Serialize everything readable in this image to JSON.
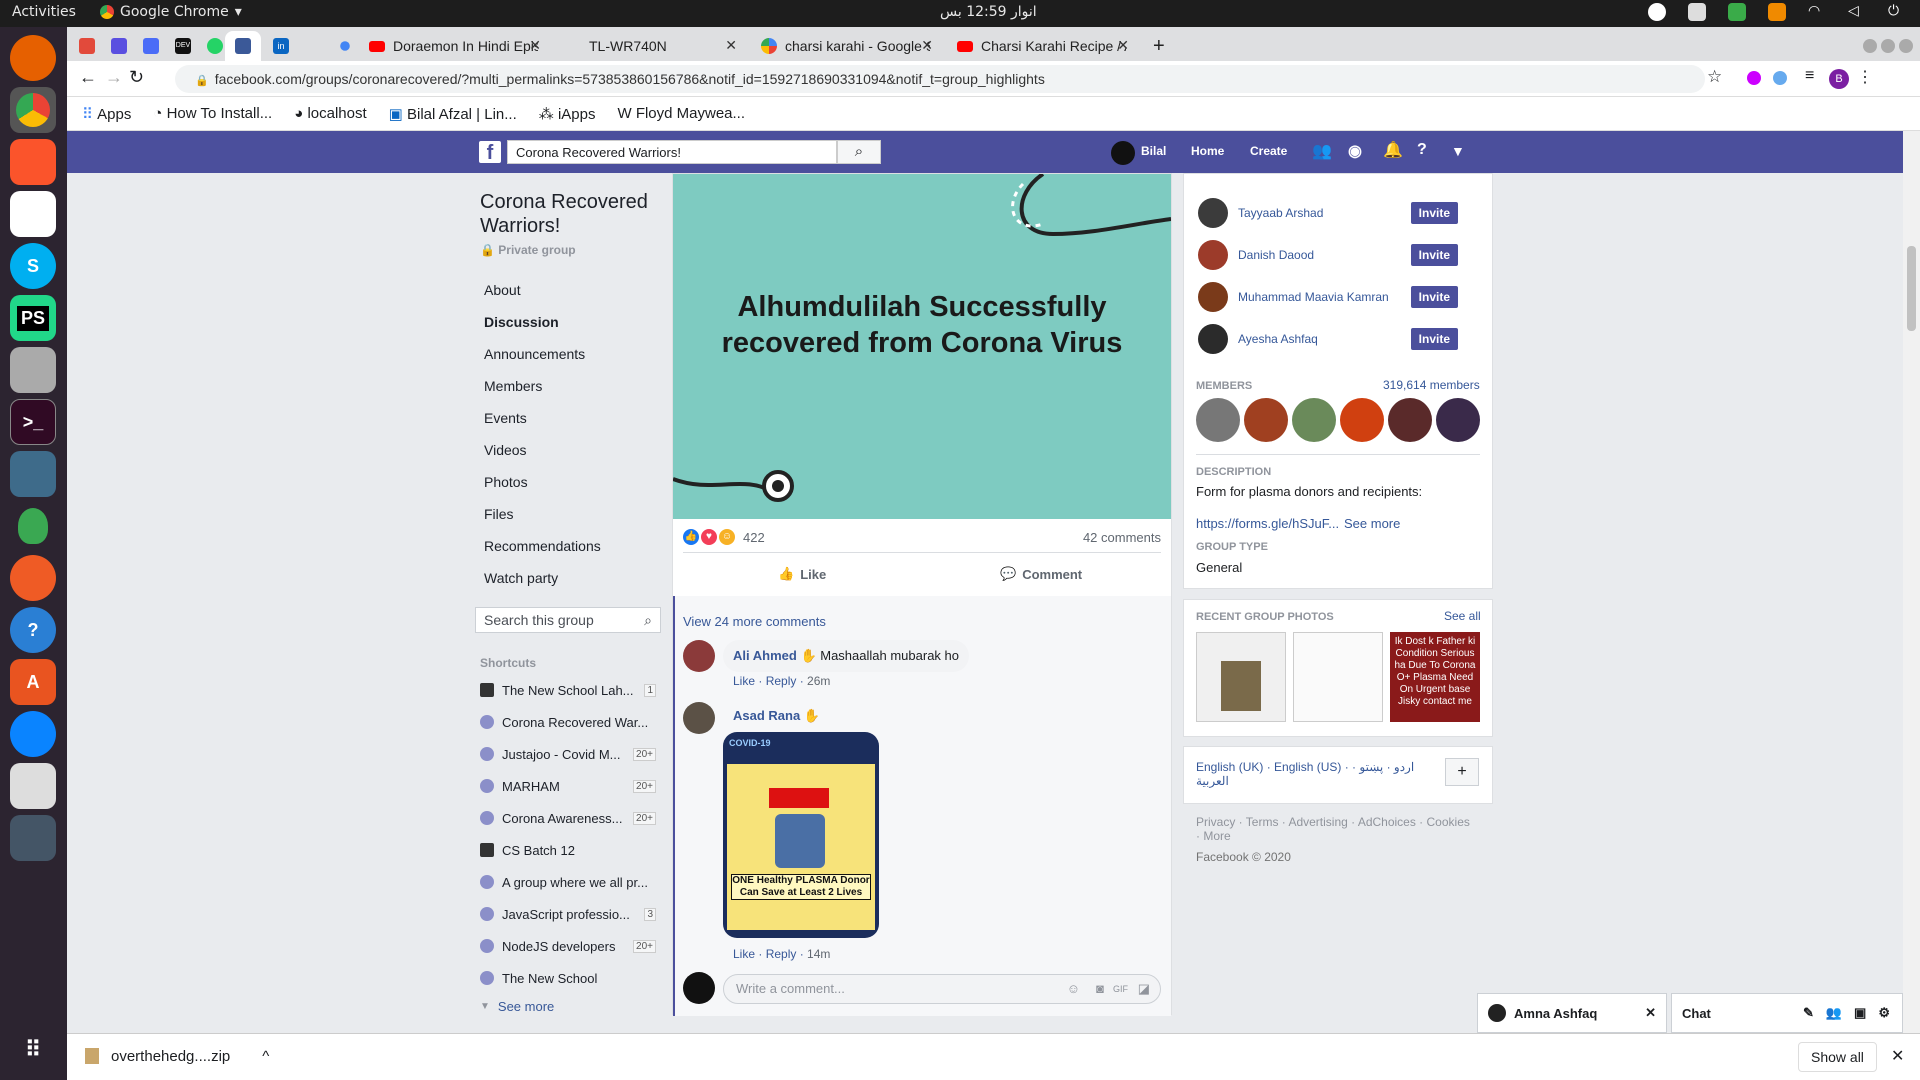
{
  "os": {
    "activities": "Activities",
    "app_name": "Google Chrome",
    "clock": "انوار 12:59 بس"
  },
  "tabs": [
    {
      "label": "",
      "color": "#e24a3b"
    },
    {
      "label": "",
      "color": "#5a4fe0"
    },
    {
      "label": "",
      "color": "#4a6cf7"
    },
    {
      "label": "DEV",
      "color": "#111"
    },
    {
      "label": "",
      "color": "#25d366"
    },
    {
      "label": "",
      "color": "#3b5998"
    },
    {
      "label": "in",
      "color": "#0a66c2"
    },
    {
      "label": "",
      "color": "#888"
    },
    {
      "label": "",
      "color": "#4285f4"
    },
    {
      "label": "Doraemon In Hindi Episo",
      "color": "#ff0000"
    },
    {
      "label": "TL-WR740N",
      "color": "#888"
    },
    {
      "label": "charsi karahi - Google Sea",
      "color": "#4285f4"
    },
    {
      "label": "Charsi Karahi Recipe / Aut",
      "color": "#ff0000"
    }
  ],
  "address": "facebook.com/groups/coronarecovered/?multi_permalinks=573853860156786&notif_id=1592718690331094&notif_t=group_highlights",
  "bookmarks": [
    "Apps",
    "How To Install...",
    "localhost",
    "Bilal Afzal | Lin...",
    "iApps",
    "Floyd Maywea..."
  ],
  "fb": {
    "search_value": "Corona Recovered Warriors!",
    "user": "Bilal",
    "home": "Home",
    "create": "Create"
  },
  "group": {
    "title": "Corona Recovered Warriors!",
    "privacy": "Private group",
    "nav": [
      "About",
      "Discussion",
      "Announcements",
      "Members",
      "Events",
      "Videos",
      "Photos",
      "Files",
      "Recommendations",
      "Watch party"
    ],
    "search_placeholder": "Search this group",
    "shortcuts_title": "Shortcuts",
    "shortcuts": [
      {
        "name": "The New School Lah...",
        "badge": "1",
        "icon": "cap"
      },
      {
        "name": "Corona Recovered War...",
        "badge": "",
        "icon": "group"
      },
      {
        "name": "Justajoo - Covid M...",
        "badge": "20+",
        "icon": "group"
      },
      {
        "name": "MARHAM",
        "badge": "20+",
        "icon": "group"
      },
      {
        "name": "Corona Awareness...",
        "badge": "20+",
        "icon": "group"
      },
      {
        "name": "CS Batch 12",
        "badge": "",
        "icon": "cap"
      },
      {
        "name": "A group where we all pr...",
        "badge": "",
        "icon": "group"
      },
      {
        "name": "JavaScript professio...",
        "badge": "3",
        "icon": "group"
      },
      {
        "name": "NodeJS developers",
        "badge": "20+",
        "icon": "group"
      },
      {
        "name": "The New School",
        "badge": "",
        "icon": "group"
      }
    ],
    "see_more": "See more"
  },
  "post": {
    "banner_text": "Alhumdulilah Successfully recovered from Corona Virus",
    "reaction_count": "422",
    "comments_count": "42 comments",
    "like": "Like",
    "comment": "Comment",
    "view_more": "View 24 more comments",
    "comments": [
      {
        "author": "Ali Ahmed",
        "text": "Mashaallah mubarak ho",
        "like": "Like",
        "reply": "Reply",
        "time": "26m"
      },
      {
        "author": "Asad Rana",
        "text": "",
        "like": "Like",
        "reply": "Reply",
        "time": "14m"
      }
    ],
    "poster": {
      "top": "COVID-19",
      "donor": "ONE Healthy PLASMA Donor Can Save at Least 2 Lives"
    },
    "compose_placeholder": "Write a comment..."
  },
  "right": {
    "invite_label": "Invite",
    "suggested": [
      "Tayyaab Arshad",
      "Danish Daood",
      "Muhammad Maavia Kamran",
      "Ayesha Ashfaq"
    ],
    "members_title": "MEMBERS",
    "members_count": "319,614 members",
    "desc_title": "DESCRIPTION",
    "desc_text": "Form for plasma donors and recipients:",
    "desc_link": "https://forms.gle/hSJuF...",
    "desc_see_more": "See more",
    "type_title": "GROUP TYPE",
    "type_value": "General",
    "photos_title": "RECENT GROUP PHOTOS",
    "photos_see_all": "See all",
    "photo3_text": "Ik Dost k Father ki Condition Serious ha Due To Corona O+ Plasma Need On Urgent base Jisky contact me",
    "langs": "English (UK) · English (US) · اردو · پښتو · العربية",
    "footer": "Privacy · Terms · Advertising · AdChoices · Cookies · More",
    "copyright": "Facebook © 2020"
  },
  "chat": {
    "user": "Amna Ashfaq",
    "label": "Chat"
  },
  "download": {
    "file": "overthehedg....zip",
    "show_all": "Show all"
  }
}
